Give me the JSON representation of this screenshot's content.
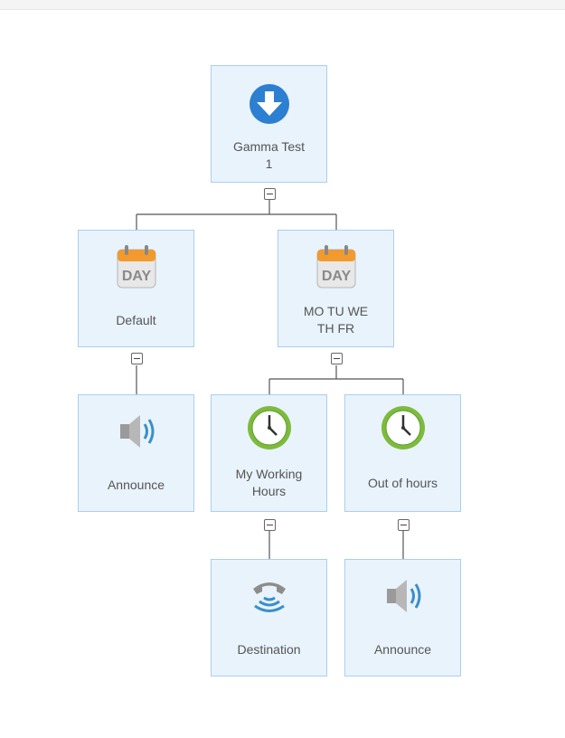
{
  "nodes": {
    "root": {
      "label": "Gamma Test\n1",
      "icon": "download-arrow-icon"
    },
    "default": {
      "label": "Default",
      "icon": "calendar-day-icon",
      "icon_text": "DAY"
    },
    "weekdays": {
      "label": "MO TU WE\nTH FR",
      "icon": "calendar-day-icon",
      "icon_text": "DAY"
    },
    "announce_default": {
      "label": "Announce",
      "icon": "speaker-icon"
    },
    "working_hours": {
      "label": "My Working\nHours",
      "icon": "clock-icon"
    },
    "out_of_hours": {
      "label": "Out of hours",
      "icon": "clock-icon"
    },
    "destination": {
      "label": "Destination",
      "icon": "phone-icon"
    },
    "announce_ooh": {
      "label": "Announce",
      "icon": "speaker-icon"
    }
  },
  "colors": {
    "node_bg": "#e9f3fc",
    "node_border": "#a9cfee",
    "accent_blue": "#2c7fd1",
    "calendar_orange": "#f29a2e",
    "clock_green": "#7dbb3c",
    "speaker_blue": "#3b8fc9"
  }
}
